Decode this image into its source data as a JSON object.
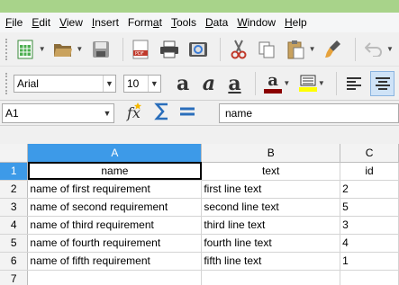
{
  "menu": {
    "items": [
      {
        "label": "File",
        "u": "F",
        "rest": "ile"
      },
      {
        "label": "Edit",
        "u": "E",
        "rest": "dit"
      },
      {
        "label": "View",
        "u": "V",
        "rest": "iew"
      },
      {
        "label": "Insert",
        "u": "I",
        "rest": "nsert"
      },
      {
        "label": "Format",
        "pre": "Form",
        "u": "a",
        "rest": "t"
      },
      {
        "label": "Tools",
        "u": "T",
        "rest": "ools"
      },
      {
        "label": "Data",
        "u": "D",
        "rest": "ata"
      },
      {
        "label": "Window",
        "u": "W",
        "rest": "indow"
      },
      {
        "label": "Help",
        "u": "H",
        "rest": "elp"
      }
    ]
  },
  "format": {
    "font_name": "Arial",
    "font_size": "10"
  },
  "formula": {
    "cell_ref": "A1",
    "content": "name"
  },
  "colors": {
    "accent": "#3d9ae8",
    "font_color_bar": "#8b0000",
    "highlight_bar": "#ffff00"
  },
  "sheet": {
    "columns": [
      "A",
      "B",
      "C"
    ],
    "rows": [
      "1",
      "2",
      "3",
      "4",
      "5",
      "6",
      "7"
    ],
    "cells": [
      [
        "name",
        "text",
        "id"
      ],
      [
        "name of first requirement",
        "first line text",
        "2"
      ],
      [
        "name of second requirement",
        "second line text",
        "5"
      ],
      [
        "name of third requirement",
        "third line text",
        "3"
      ],
      [
        "name of fourth requirement",
        "fourth line text",
        "4"
      ],
      [
        "name of fifth requirement",
        "fifth line text",
        "1"
      ],
      [
        "",
        "",
        ""
      ]
    ]
  }
}
